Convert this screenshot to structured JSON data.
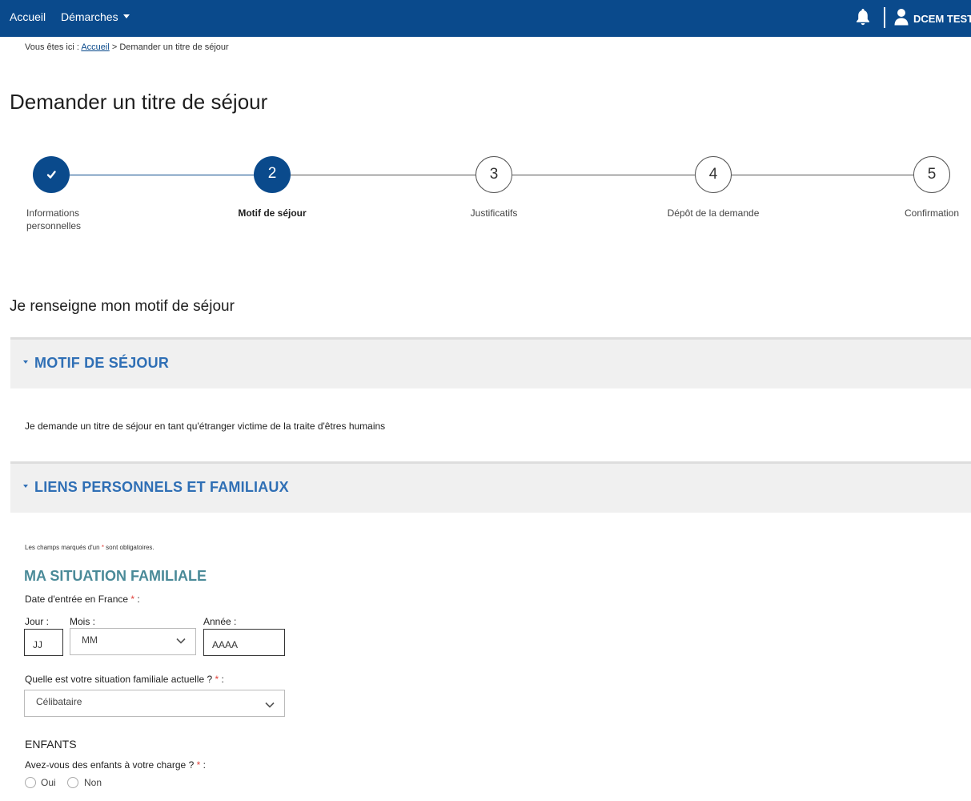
{
  "nav": {
    "home": "Accueil",
    "demarches": "Démarches",
    "user_name": "DCEM TEST"
  },
  "breadcrumb": {
    "prefix": "Vous êtes ici :",
    "home_link": "Accueil",
    "separator": ">",
    "current": "Demander un titre de séjour"
  },
  "page_title": "Demander un titre de séjour",
  "stepper": {
    "steps": [
      {
        "number": "",
        "label_line1": "Informations",
        "label_line2": "personnelles",
        "state": "done"
      },
      {
        "number": "2",
        "label_line1": "Motif de séjour",
        "label_line2": "",
        "state": "current"
      },
      {
        "number": "3",
        "label_line1": "Justificatifs",
        "label_line2": "",
        "state": "todo"
      },
      {
        "number": "4",
        "label_line1": "Dépôt de la demande",
        "label_line2": "",
        "state": "todo"
      },
      {
        "number": "5",
        "label_line1": "Confirmation",
        "label_line2": "",
        "state": "todo"
      }
    ],
    "done_icon": "check-icon"
  },
  "section_title": "Je renseigne mon motif de séjour",
  "accordions": {
    "motif": {
      "title": "MOTIF DE SÉJOUR",
      "text": "Je demande un titre de séjour en tant qu'étranger victime de la traite d'êtres humains"
    },
    "liens": {
      "title": "LIENS PERSONNELS ET FAMILIAUX"
    }
  },
  "form": {
    "required_note_start": "Les champs marqués d'un",
    "required_star": "*",
    "required_note_end": "sont obligatoires.",
    "subtitle": "MA SITUATION FAMILIALE",
    "entry_date_label": "Date d'entrée en France",
    "label_colon": ":",
    "day_label": "Jour :",
    "month_label": "Mois :",
    "year_label": "Année :",
    "day_placeholder": "JJ",
    "month_value": "MM",
    "year_placeholder": "AAAA",
    "situation_label": "Quelle est votre situation familiale actuelle ?",
    "situation_value": "Célibataire",
    "children_title": "ENFANTS",
    "children_question": "Avez-vous des enfants à votre charge ?",
    "option_yes": "Oui",
    "option_no": "Non"
  },
  "colors": {
    "nav_bg": "#0a4a8c",
    "accent_blue": "#2f6fb5",
    "subtitle_teal": "#4a8a98",
    "required_red": "#e0403a",
    "panel_bg": "#f0f0f0"
  }
}
